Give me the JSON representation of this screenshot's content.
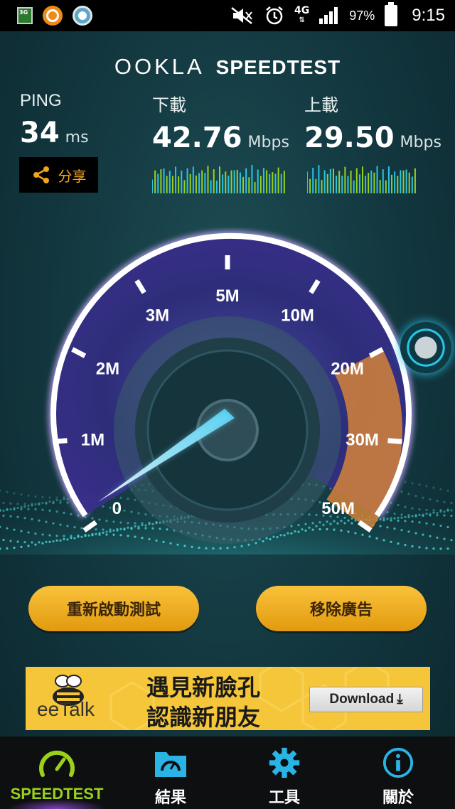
{
  "status_bar": {
    "network": "4G",
    "battery": "97%",
    "time": "9:15"
  },
  "header": {
    "brand_left": "OOKLA",
    "brand_right": "SPEEDTEST"
  },
  "stats": {
    "ping": {
      "label": "PING",
      "value": "34",
      "unit": "ms"
    },
    "download": {
      "label": "下載",
      "value": "42.76",
      "unit": "Mbps"
    },
    "upload": {
      "label": "上載",
      "value": "29.50",
      "unit": "Mbps"
    }
  },
  "share_label": "分享",
  "gauge": {
    "scale_labels": [
      "0",
      "1M",
      "2M",
      "3M",
      "5M",
      "10M",
      "20M",
      "30M",
      "50M"
    ],
    "colors": {
      "rim": "#b98cff",
      "highlight": "#e28b2b",
      "needle": "#6fe0ff"
    }
  },
  "actions": {
    "restart": "重新啟動測試",
    "remove_ads": "移除廣告"
  },
  "ad": {
    "brand": "eeTalk",
    "line1": "遇見新臉孔",
    "line2": "認識新朋友",
    "download": "Download"
  },
  "bottom_nav": [
    {
      "label": "SPEEDTEST",
      "icon": "speedometer-icon",
      "active": true
    },
    {
      "label": "結果",
      "icon": "folder-gauge-icon",
      "active": false
    },
    {
      "label": "工具",
      "icon": "gear-icon",
      "active": false
    },
    {
      "label": "關於",
      "icon": "info-icon",
      "active": false
    }
  ]
}
